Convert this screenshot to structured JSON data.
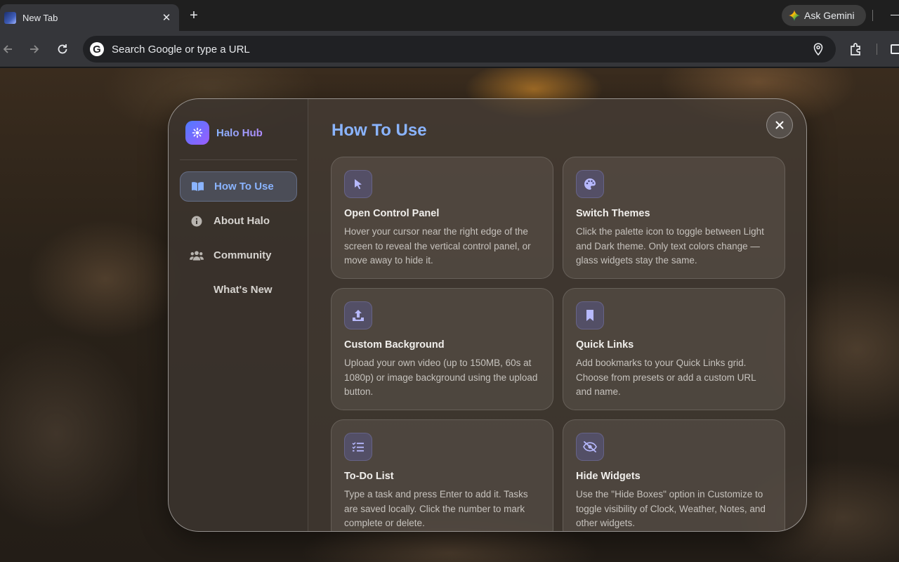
{
  "browser": {
    "tab_title": "New Tab",
    "tab_close": "✕",
    "new_tab": "+",
    "gemini_label": "Ask Gemini",
    "omnibox_placeholder": "Search Google or type a URL",
    "google_letter": "G"
  },
  "sidebar": {
    "brand_name": "Halo Hub",
    "items": [
      {
        "label": "How To Use",
        "icon": "book-icon",
        "active": true
      },
      {
        "label": "About Halo",
        "icon": "info-icon",
        "active": false
      },
      {
        "label": "Community",
        "icon": "users-icon",
        "active": false
      },
      {
        "label": "What's New",
        "icon": "",
        "active": false
      }
    ]
  },
  "main": {
    "title": "How To Use",
    "close_label": "✕",
    "cards": [
      {
        "title": "Open Control Panel",
        "icon": "cursor-icon",
        "description": "Hover your cursor near the right edge of the screen to reveal the vertical control panel, or move away to hide it."
      },
      {
        "title": "Switch Themes",
        "icon": "palette-icon",
        "description": "Click the palette icon to toggle between Light and Dark theme. Only text colors change — glass widgets stay the same."
      },
      {
        "title": "Custom Background",
        "icon": "upload-icon",
        "description": "Upload your own video (up to 150MB, 60s at 1080p) or image background using the upload button."
      },
      {
        "title": "Quick Links",
        "icon": "bookmark-icon",
        "description": "Add bookmarks to your Quick Links grid. Choose from presets or add a custom URL and name."
      },
      {
        "title": "To-Do List",
        "icon": "checklist-icon",
        "description": "Type a task and press Enter to add it. Tasks are saved locally. Click the number to mark complete or delete."
      },
      {
        "title": "Hide Widgets",
        "icon": "eye-slash-icon",
        "description": "Use the \"Hide Boxes\" option in Customize to toggle visibility of Clock, Weather, Notes, and other widgets."
      }
    ]
  },
  "colors": {
    "accent": "#8ab4ff",
    "brand_gradient_start": "#4f7bff",
    "brand_gradient_end": "#9b5cff"
  }
}
